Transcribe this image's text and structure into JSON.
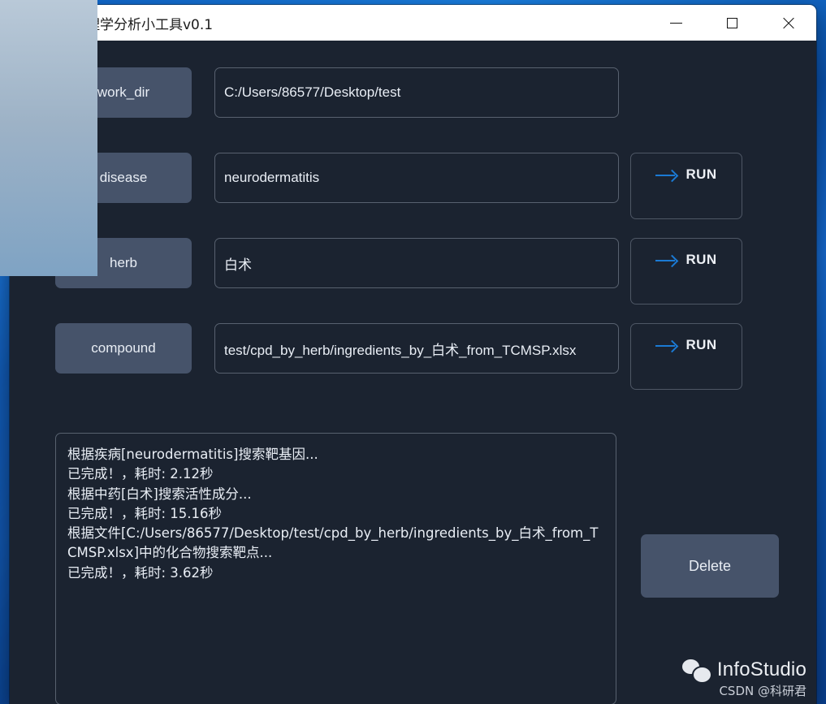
{
  "window": {
    "title": "网络药理学分析小工具v0.1",
    "icon": "app-image-icon",
    "controls": {
      "minimize": "minimize-icon",
      "maximize": "maximize-icon",
      "close": "close-icon"
    }
  },
  "colors": {
    "app_background": "#1b2330",
    "button_background": "#46536a",
    "input_border": "#58616f",
    "run_arrow_blue": "#1b7ad4",
    "text": "#e9eef5",
    "titlebar_background": "#ffffff",
    "titlebar_text": "#1b1b1b"
  },
  "rows": [
    {
      "key": "work_dir",
      "button_label": "work_dir",
      "input_value": "C:/Users/86577/Desktop/test",
      "input_placeholder": "",
      "has_run": false,
      "run_label": ""
    },
    {
      "key": "disease",
      "button_label": "disease",
      "input_value": "neurodermatitis",
      "input_placeholder": "",
      "has_run": true,
      "run_label": "RUN"
    },
    {
      "key": "herb",
      "button_label": "herb",
      "input_value": "白术",
      "input_placeholder": "",
      "has_run": true,
      "run_label": "RUN"
    },
    {
      "key": "compound",
      "button_label": "compound",
      "input_value": "test/cpd_by_herb/ingredients_by_白术_from_TCMSP.xlsx",
      "input_placeholder": "",
      "has_run": true,
      "run_label": "RUN"
    }
  ],
  "log": {
    "lines": [
      "根据疾病[neurodermatitis]搜索靶基因...",
      "已完成！，耗时: 2.12秒",
      "根据中药[白术]搜索活性成分...",
      "已完成！，耗时: 15.16秒",
      "根据文件[C:/Users/86577/Desktop/test/cpd_by_herb/ingredients_by_白术_from_TCMSP.xlsx]中的化合物搜索靶点...",
      "已完成！，耗时: 3.62秒"
    ],
    "text": "根据疾病[neurodermatitis]搜索靶基因...\n已完成！，耗时: 2.12秒\n根据中药[白术]搜索活性成分...\n已完成！，耗时: 15.16秒\n根据文件[C:/Users/86577/Desktop/test/cpd_by_herb/ingredients_by_白术_from_TCMSP.xlsx]中的化合物搜索靶点...\n已完成！，耗时: 3.62秒"
  },
  "delete_button": {
    "label": "Delete"
  },
  "watermark": {
    "icon": "wechat-icon",
    "name": "InfoStudio",
    "subtitle": "CSDN @科研君"
  }
}
